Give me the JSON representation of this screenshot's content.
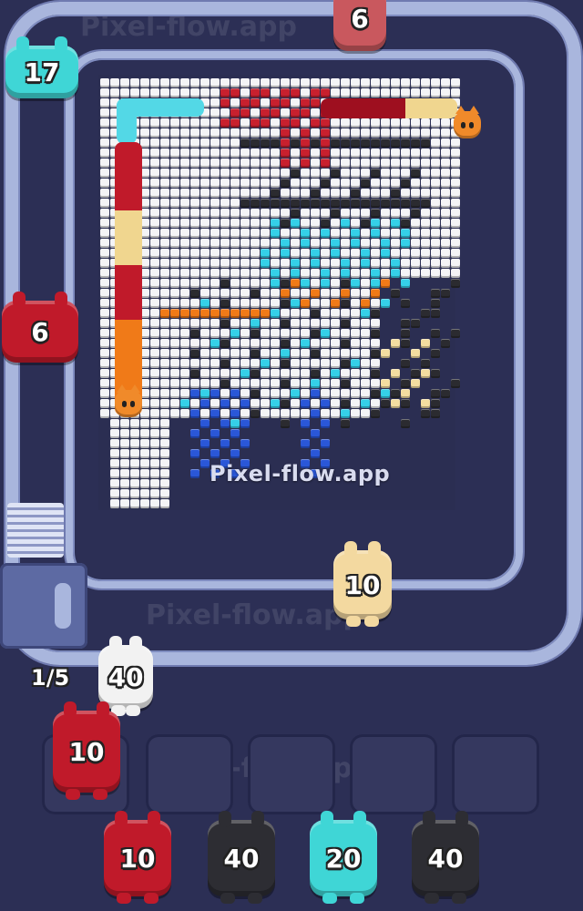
{
  "game": {
    "watermark": "Pixel-flow.app",
    "site_label": "Pixel-flow.app",
    "queue_counter": "1/5",
    "track_pigs": [
      {
        "value": "6",
        "color": "#c9585e"
      },
      {
        "value": "17",
        "color": "#3fd6d6"
      },
      {
        "value": "6",
        "color": "#c01a2a"
      },
      {
        "value": "10",
        "color": "#f3d9a0"
      }
    ],
    "queue_pig": {
      "value": "40",
      "color": "#f2f2f2"
    },
    "active_pig": {
      "value": "10",
      "color": "#c01a2a"
    },
    "bottom_pigs": [
      {
        "value": "10",
        "color": "#c01a2a"
      },
      {
        "value": "40",
        "color": "#2d2d33"
      },
      {
        "value": "20",
        "color": "#3fd6d6"
      },
      {
        "value": "40",
        "color": "#2d2d33"
      }
    ],
    "palette": {
      "white": "#f4f4f6",
      "black": "#2b2b30",
      "red": "#c8202e",
      "cyan": "#35d0e8",
      "orange": "#f07a18",
      "blue": "#2a57d8",
      "cream": "#f3dda0",
      "gray": "#9aa0b8"
    }
  }
}
